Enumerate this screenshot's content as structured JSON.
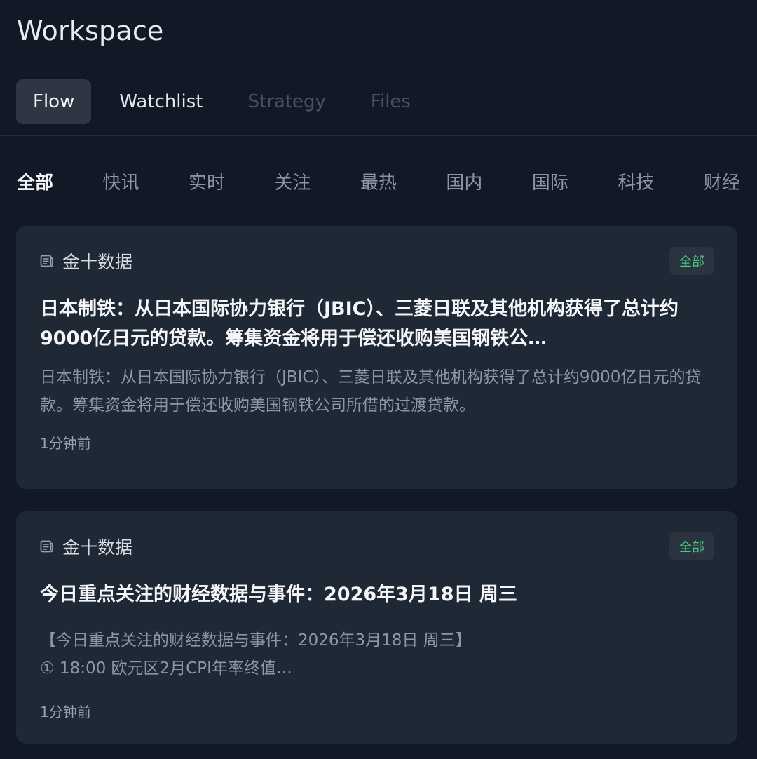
{
  "header": {
    "title": "Workspace"
  },
  "tabs": [
    {
      "label": "Flow",
      "state": "active"
    },
    {
      "label": "Watchlist",
      "state": "normal"
    },
    {
      "label": "Strategy",
      "state": "disabled"
    },
    {
      "label": "Files",
      "state": "disabled"
    }
  ],
  "filters": [
    "全部",
    "快讯",
    "实时",
    "关注",
    "最热",
    "国内",
    "国际",
    "科技",
    "财经"
  ],
  "selected_filter": "全部",
  "cards": [
    {
      "source": "金十数据",
      "source_icon": "news-icon",
      "badge": "全部",
      "headline": "日本制铁：从日本国际协力银行（JBIC）、三菱日联及其他机构获得了总计约9000亿日元的贷款。筹集资金将用于偿还收购美国钢铁公…",
      "summary": "日本制铁：从日本国际协力银行（JBIC）、三菱日联及其他机构获得了总计约9000亿日元的贷款。筹集资金将用于偿还收购美国钢铁公司所借的过渡贷款。",
      "time": "1分钟前"
    },
    {
      "source": "金十数据",
      "source_icon": "news-icon",
      "badge": "全部",
      "headline": "今日重点关注的财经数据与事件：2026年3月18日 周三",
      "summary_line1": "【今日重点关注的财经数据与事件：2026年3月18日 周三】",
      "summary_line2": "① 18:00 欧元区2月CPI年率终值…",
      "time": "1分钟前"
    }
  ],
  "colors": {
    "background": "#111826",
    "card": "#1f2835",
    "badge_text": "#4cc97a",
    "active_tab": "#2e3644"
  }
}
